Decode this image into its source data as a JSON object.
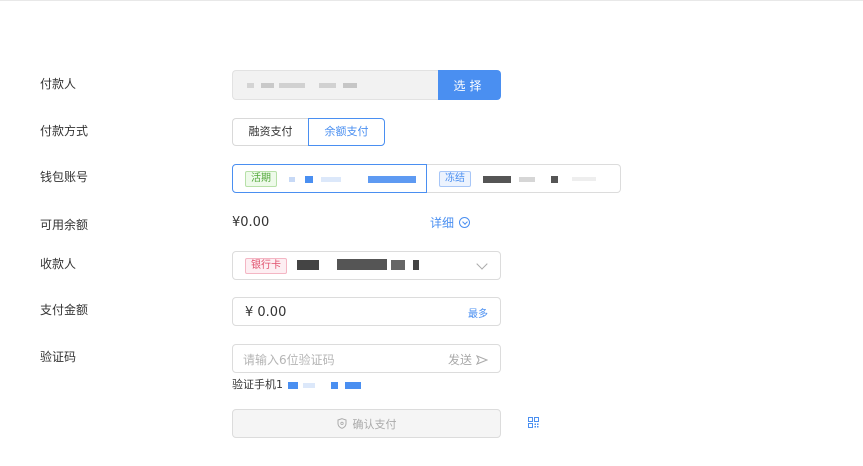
{
  "form": {
    "payer_label": "付款人",
    "select_button": "选择",
    "method_label": "付款方式",
    "methods": [
      "融资支付",
      "余额支付"
    ],
    "wallet_label": "钱包账号",
    "wallets": [
      {
        "tag": "活期"
      },
      {
        "tag": "冻结"
      }
    ],
    "balance_label": "可用余额",
    "balance_value": "¥0.00",
    "detail_link": "详细",
    "payee_label": "收款人",
    "payee_tag": "银行卡",
    "amount_label": "支付金额",
    "amount_value": "¥ 0.00",
    "max_link": "最多",
    "code_label": "验证码",
    "code_placeholder": "请输入6位验证码",
    "send_label": "发送",
    "phone_prefix": "验证手机1",
    "confirm_button": "确认支付"
  },
  "colors": {
    "accent": "#4a8ff1",
    "green_tag": "#52a83a",
    "pink_tag": "#e0506c"
  },
  "icons": [
    "chevron-down-circle-icon",
    "chevron-down-icon",
    "send-icon",
    "shield-icon",
    "qr-code-icon"
  ]
}
